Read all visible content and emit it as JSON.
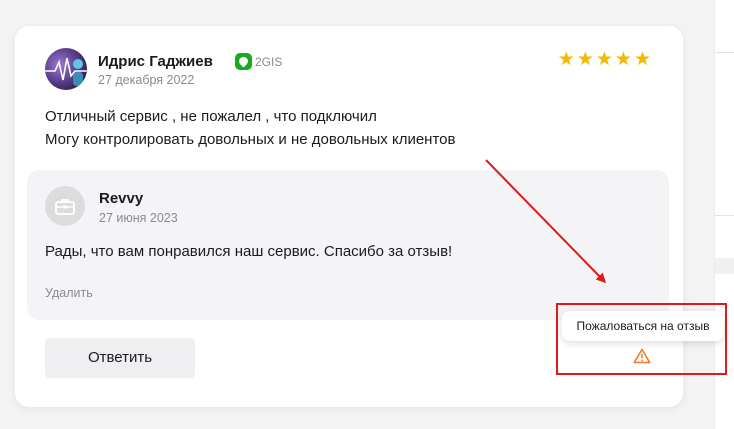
{
  "review": {
    "author": "Идрис Гаджиев",
    "source": "2GIS",
    "date": "27 декабря 2022",
    "rating": 5,
    "text_lines": [
      "Отличный сервис , не пожалел , что подключил",
      "Могу контролировать довольных и не довольных клиентов"
    ]
  },
  "reply": {
    "author": "Revvy",
    "date": "27 июня 2023",
    "text": "Рады, что вам понравился наш сервис. Спасибо за отзыв!",
    "delete_label": "Удалить"
  },
  "actions": {
    "reply_button_label": "Ответить",
    "report_tooltip": "Пожаловаться на отзыв"
  },
  "icons": {
    "source_icon": "2gis-logo-icon",
    "reply_avatar_icon": "briefcase-icon",
    "report_icon": "warning-triangle-icon",
    "star_icon": "star-icon"
  },
  "colors": {
    "star": "#f5b800",
    "brand_2gis": "#19aa1e",
    "warning": "#f07c2a",
    "annotation": "#e01a1a"
  }
}
